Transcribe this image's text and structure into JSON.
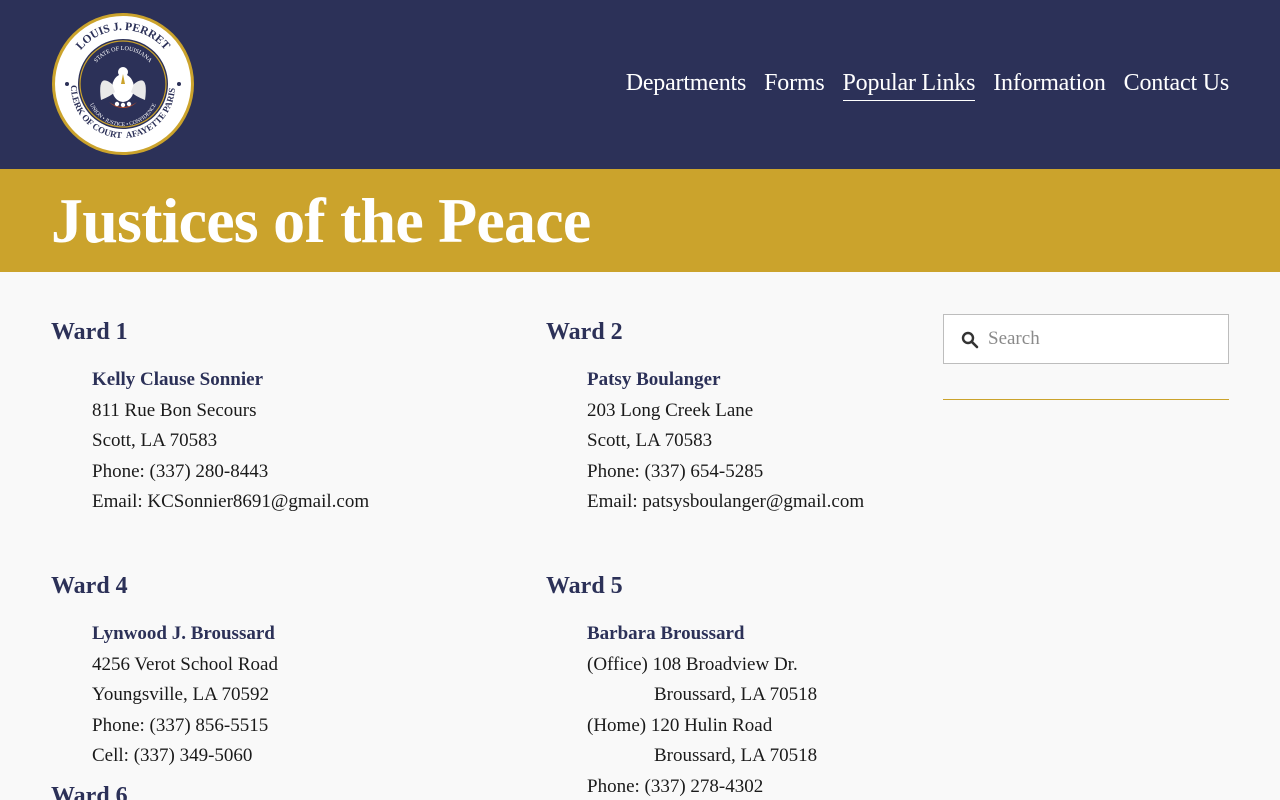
{
  "logo": {
    "top_arc": "LOUIS J. PERRET",
    "state": "STATE OF LOUISIANA",
    "motto": "UNION • JUSTICE • CONFIDENCE",
    "bottom_left": "CLERK OF COURT",
    "bottom_right": "LAFAYETTE PARISH"
  },
  "nav": [
    {
      "label": "Departments"
    },
    {
      "label": "Forms"
    },
    {
      "label": "Popular Links"
    },
    {
      "label": "Information"
    },
    {
      "label": "Contact Us"
    }
  ],
  "active_nav": "Popular Links",
  "page_title": "Justices of the Peace",
  "wards": {
    "w1": {
      "title": "Ward 1",
      "name": "Kelly Clause Sonnier",
      "lines": [
        "811 Rue Bon Secours",
        "Scott, LA 70583",
        "Phone: (337) 280-8443",
        "Email: KCSonnier8691@gmail.com"
      ]
    },
    "w2": {
      "title": "Ward 2",
      "name": "Patsy Boulanger",
      "lines": [
        "203 Long Creek Lane",
        "Scott, LA 70583",
        "Phone: (337) 654-5285",
        "Email: patsysboulanger@gmail.com"
      ]
    },
    "w4": {
      "title": "Ward 4",
      "name": "Lynwood J. Broussard",
      "lines": [
        "4256 Verot School Road",
        "Youngsville, LA 70592",
        "Phone: (337) 856-5515",
        "Cell: (337) 349-5060"
      ]
    },
    "w5": {
      "title": "Ward 5",
      "name": "Barbara Broussard",
      "office": "(Office) 108 Broadview Dr.",
      "office_city": "Broussard, LA 70518",
      "home": "(Home) 120 Hulin Road",
      "home_city": "Broussard, LA 70518",
      "phone": "Phone: (337) 278-4302"
    },
    "w6": {
      "title": "Ward 6"
    }
  },
  "search": {
    "placeholder": "Search"
  },
  "colors": {
    "navy": "#2c3158",
    "gold": "#cba32c",
    "background": "#f9f9f9"
  }
}
